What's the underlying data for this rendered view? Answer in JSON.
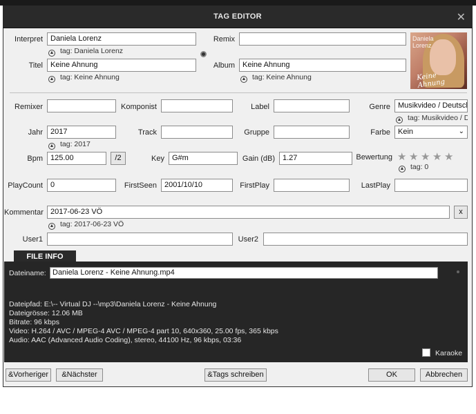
{
  "window": {
    "title": "TAG EDITOR",
    "close_glyph": "✕"
  },
  "fields": {
    "interpret": {
      "label": "Interpret",
      "value": "Daniela Lorenz",
      "tag": "tag: Daniela Lorenz"
    },
    "remix": {
      "label": "Remix",
      "value": ""
    },
    "titel": {
      "label": "Titel",
      "value": "Keine Ahnung",
      "tag": "tag: Keine Ahnung"
    },
    "album": {
      "label": "Album",
      "value": "Keine Ahnung",
      "tag": "tag: Keine Ahnung"
    },
    "cover": {
      "line1": "Daniela",
      "line2": "Lorenz",
      "script1": "Keine",
      "script2": "Ahnung"
    },
    "remixer": {
      "label": "Remixer",
      "value": ""
    },
    "komponist": {
      "label": "Komponist",
      "value": ""
    },
    "label": {
      "label": "Label",
      "value": ""
    },
    "genre": {
      "label": "Genre",
      "value": "Musikvideo / Deutsch",
      "tag": "tag: Musikvideo / D"
    },
    "jahr": {
      "label": "Jahr",
      "value": "2017",
      "tag": "tag: 2017"
    },
    "track": {
      "label": "Track",
      "value": ""
    },
    "gruppe": {
      "label": "Gruppe",
      "value": ""
    },
    "farbe": {
      "label": "Farbe",
      "value": "Kein"
    },
    "bpm": {
      "label": "Bpm",
      "value": "125.00",
      "half_button": "/2"
    },
    "key": {
      "label": "Key",
      "value": "G#m"
    },
    "gain": {
      "label": "Gain (dB)",
      "value": "1.27"
    },
    "bewertung": {
      "label": "Bewertung",
      "tag": "tag: 0",
      "stars": 0,
      "max_stars": 5
    },
    "playcount": {
      "label": "PlayCount",
      "value": "0"
    },
    "firstseen": {
      "label": "FirstSeen",
      "value": "2001/10/10"
    },
    "firstplay": {
      "label": "FirstPlay",
      "value": ""
    },
    "lastplay": {
      "label": "LastPlay",
      "value": ""
    },
    "kommentar": {
      "label": "Kommentar",
      "value": "2017-06-23 VÖ",
      "tag": "tag: 2017-06-23 VÖ",
      "clear_button": "x"
    },
    "user1": {
      "label": "User1",
      "value": ""
    },
    "user2": {
      "label": "User2",
      "value": ""
    }
  },
  "file_info": {
    "tab": "FILE INFO",
    "dateiname_label": "Dateiname:",
    "dateiname": "Daniela Lorenz - Keine Ahnung.mp4",
    "lines": [
      "Dateipfad: E:\\-- Virtual DJ --\\mp3\\Daniela Lorenz - Keine Ahnung",
      "Dateigrösse: 12.06 MB",
      "Bitrate: 96 kbps",
      "Video: H.264 / AVC / MPEG-4 AVC / MPEG-4 part 10, 640x360, 25.00 fps, 365 kbps",
      "Audio: AAC (Advanced Audio Coding), stereo, 44100 Hz, 96 kbps, 03:36"
    ],
    "karaoke_label": "Karaoke"
  },
  "buttons": {
    "prev": "&Vorheriger",
    "next": "&Nächster",
    "write_tags": "&Tags schreiben",
    "ok": "OK",
    "cancel": "Abbrechen"
  },
  "colors": {
    "titlebar": "#2a2a2a",
    "panel": "#f0f0f0",
    "file_info_bg": "#262626"
  }
}
